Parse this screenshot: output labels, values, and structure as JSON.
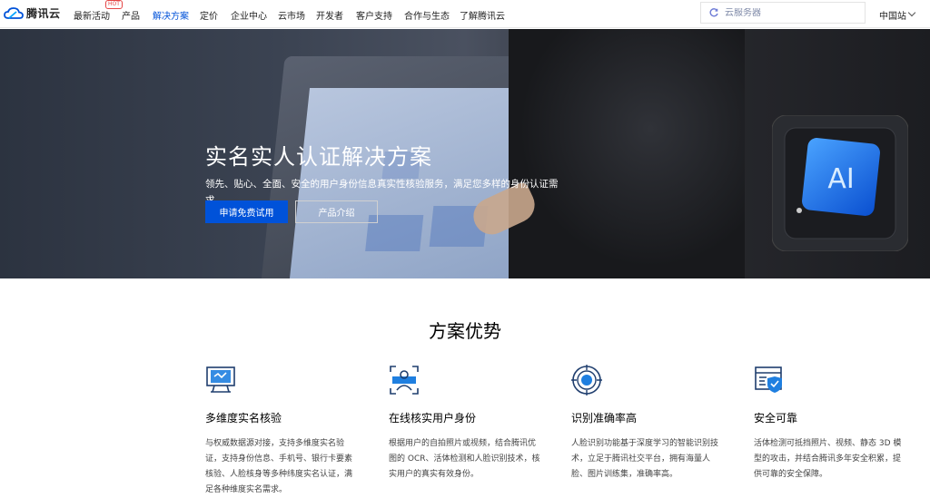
{
  "nav": {
    "logo_text": "腾讯云",
    "items": [
      "最新活动",
      "产品",
      "解决方案",
      "定价",
      "企业中心",
      "云市场",
      "开发者",
      "客户支持",
      "合作与生态",
      "了解腾讯云"
    ],
    "hot_badge": "HOT",
    "search_placeholder": "云服务器",
    "region": "中国站"
  },
  "hero": {
    "title": "实名实人认证解决方案",
    "description": "领先、贴心、全面、安全的用户身份信息真实性核验服务，满足您多样的身份认证需求。",
    "primary_button": "申请免费试用",
    "secondary_button": "产品介绍",
    "chip_label": "AI"
  },
  "advantages": {
    "title": "方案优势",
    "items": [
      {
        "icon": "identity-verify-icon",
        "title": "多维度实名核验",
        "desc": "与权威数据源对接，支持多维度实名验证，支持身份信息、手机号、银行卡要素核验、人脸核身等多种纬度实名认证，满足各种维度实名需求。"
      },
      {
        "icon": "face-scan-icon",
        "title": "在线核实用户身份",
        "desc": "根据用户的自拍照片或视频，结合腾讯优图的 OCR、活体检测和人脸识别技术，核实用户的真实有效身份。"
      },
      {
        "icon": "target-icon",
        "title": "识别准确率高",
        "desc": "人脸识别功能基于深度学习的智能识别技术，立足于腾讯社交平台，拥有海量人脸、图片训练集，准确率高。"
      },
      {
        "icon": "shield-window-icon",
        "title": "安全可靠",
        "desc": "活体检测可抵挡照片、视频、静态 3D 模型的攻击，并结合腾讯多年安全积累，提供可靠的安全保障。"
      }
    ]
  },
  "colors": {
    "brand": "#0052d9",
    "hot": "#e54545"
  }
}
